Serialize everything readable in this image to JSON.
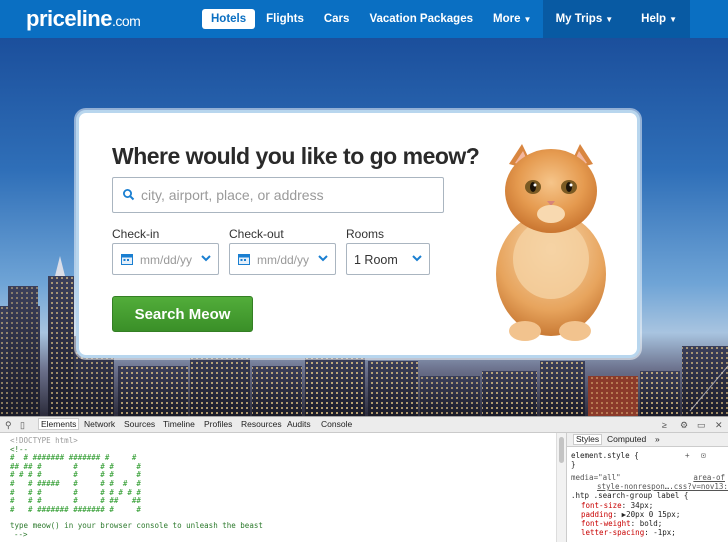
{
  "header": {
    "logo_main": "priceline",
    "logo_suffix": ".com",
    "nav": [
      {
        "label": "Hotels",
        "active": true
      },
      {
        "label": "Flights"
      },
      {
        "label": "Cars"
      },
      {
        "label": "Vacation Packages"
      },
      {
        "label": "More",
        "caret": "▼"
      }
    ],
    "nav_right": [
      {
        "label": "My Trips",
        "caret": "▼"
      },
      {
        "label": "Help",
        "caret": "▼"
      }
    ]
  },
  "search": {
    "title": "Where would you like to go meow?",
    "destination_placeholder": "city, airport, place, or address",
    "checkin_label": "Check-in",
    "checkin_value": "mm/dd/yy",
    "checkout_label": "Check-out",
    "checkout_value": "mm/dd/yy",
    "rooms_label": "Rooms",
    "rooms_value": "1 Room",
    "button_label": "Search Meow"
  },
  "devtools": {
    "tabs": [
      "Elements",
      "Network",
      "Sources",
      "Timeline",
      "Profiles",
      "Resources",
      "Audits",
      "Console"
    ],
    "active_tab": "Elements",
    "source_lines": {
      "doctype": "<!DOCTYPE html>",
      "comment_open": "<!--",
      "art": [
        "#  # ####### ####### #     #",
        "## ## #       #     # #     #",
        "# # # #       #     # #     #",
        "#   # #####   #     # #  #  #",
        "#   # #       #     # # # # #",
        "#   # #       #     # ##   ##",
        "#   # ####### ####### #     #"
      ],
      "message": "type meow() in your browser console to unleash the beast",
      "comment_close": "-->"
    },
    "styles_tabs": [
      "Styles",
      "Computed"
    ],
    "styles_active": "Styles",
    "styles_more": "»",
    "element_style": "element.style {",
    "element_style_close": "}",
    "media_line": "media=\"all\"",
    "media_link": "area-of",
    "source_link": "style-nonrespon….css?v=nov13:1",
    "selector": ".htp .search-group label {",
    "props": [
      {
        "name": "font-size",
        "value": "34px;"
      },
      {
        "name": "padding",
        "value": "▶20px 0 15px;"
      },
      {
        "name": "font-weight",
        "value": "bold;"
      },
      {
        "name": "letter-spacing",
        "value": "-1px;"
      }
    ]
  }
}
